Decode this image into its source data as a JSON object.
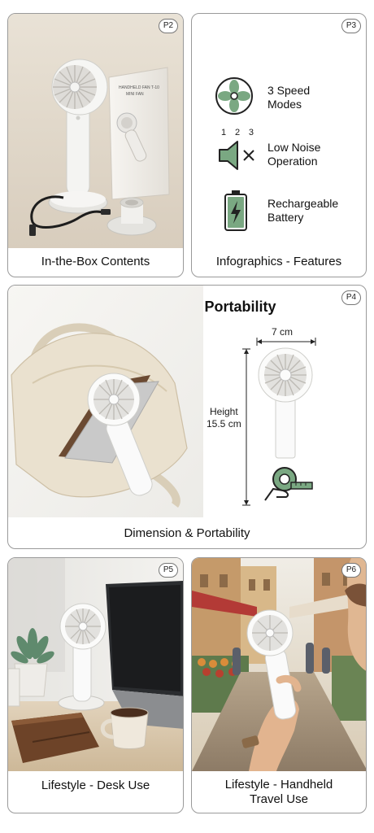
{
  "panels": {
    "p2": {
      "badge": "P2",
      "caption": "In-the-Box Contents",
      "box_title": "HANDHELD FAN T-10",
      "box_subtitle": "MINI FAN"
    },
    "p3": {
      "badge": "P3",
      "caption": "Infographics - Features",
      "features": [
        {
          "line1": "3 Speed",
          "line2": "Modes",
          "icon": "fan-speed-icon"
        },
        {
          "line1": "Low Noise",
          "line2": "Operation",
          "icon": "speaker-mute-icon"
        },
        {
          "line1": "Rechargeable",
          "line2": "Battery",
          "icon": "battery-charging-icon"
        }
      ],
      "speed_labels": [
        "1",
        "2",
        "3"
      ],
      "accent": "#7aa882"
    },
    "p4": {
      "badge": "P4",
      "title": "Dimensions & Portability",
      "caption": "Dimension & Portability",
      "width_label": "7 cm",
      "height_label_1": "Height",
      "height_label_2": "15.5 cm"
    },
    "p5": {
      "badge": "P5",
      "caption": "Lifestyle - Desk Use"
    },
    "p6": {
      "badge": "P6",
      "caption_line1": "Lifestyle - Handheld",
      "caption_line2": "Travel Use"
    }
  }
}
